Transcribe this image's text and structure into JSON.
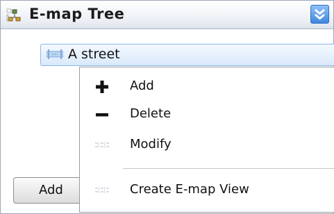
{
  "panel": {
    "title": "E-map Tree",
    "title_icon": "tree-structure-icon",
    "collapse_icon": "double-chevron-down-icon",
    "accent_color": "#3f87e0"
  },
  "tree": {
    "selected_node": {
      "label": "A street",
      "icon": "street-icon"
    }
  },
  "footer": {
    "add_button_label": "Add"
  },
  "context_menu": {
    "items": [
      {
        "label": "Add",
        "icon": "plus-icon"
      },
      {
        "label": "Delete",
        "icon": "minus-icon"
      },
      {
        "label": "Modify",
        "icon": "modify-icon"
      },
      {
        "label": "Create E-map View",
        "icon": "map-view-icon"
      }
    ]
  }
}
